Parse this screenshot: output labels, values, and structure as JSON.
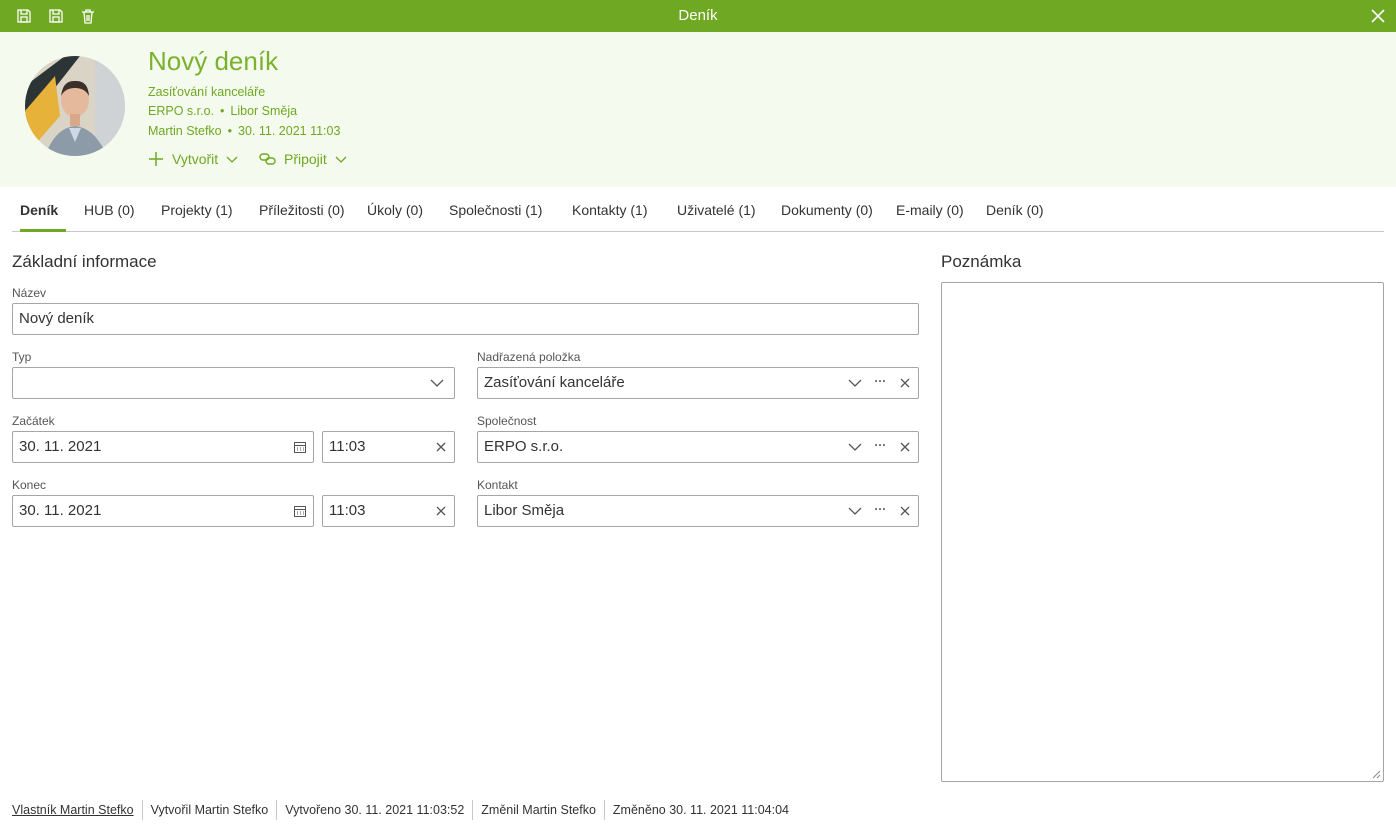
{
  "window": {
    "title": "Deník",
    "accent": "#6fa823"
  },
  "toolbar": {
    "icons": [
      "save-close-icon",
      "save-icon",
      "trash-icon"
    ]
  },
  "header": {
    "title": "Nový deník",
    "parent": "Zasíťování kanceláře",
    "company": "ERPO s.r.o.",
    "contact": "Libor Směja",
    "author": "Martin Stefko",
    "datetime": "30. 11. 2021 11:03",
    "separator": "•",
    "create_label": "Vytvořit",
    "connect_label": "Připojit"
  },
  "tabs": [
    {
      "label": "Deník"
    },
    {
      "label": "HUB (0)"
    },
    {
      "label": "Projekty (1)"
    },
    {
      "label": "Příležitosti (0)"
    },
    {
      "label": "Úkoly (0)"
    },
    {
      "label": "Společnosti (1)"
    },
    {
      "label": "Kontakty (1)"
    },
    {
      "label": "Uživatelé (1)"
    },
    {
      "label": "Dokumenty (0)"
    },
    {
      "label": "E-maily (0)"
    },
    {
      "label": "Deník (0)"
    }
  ],
  "form": {
    "section_title": "Základní informace",
    "name_label": "Název",
    "name_value": "Nový deník",
    "type_label": "Typ",
    "type_value": "",
    "parent_label": "Nadřazená položka",
    "parent_value": "Zasíťování kanceláře",
    "start_label": "Začátek",
    "start_date": "30. 11. 2021",
    "start_time": "11:03",
    "company_label": "Společnost",
    "company_value": "ERPO s.r.o.",
    "end_label": "Konec",
    "end_date": "30. 11. 2021",
    "end_time": "11:03",
    "contact_label": "Kontakt",
    "contact_value": "Libor Směja"
  },
  "note": {
    "title": "Poznámka",
    "value": ""
  },
  "footer": {
    "owner": "Vlastník Martin Stefko",
    "created_by": "Vytvořil Martin Stefko",
    "created_at": "Vytvořeno 30. 11. 2021 11:03:52",
    "modified_by": "Změnil Martin Stefko",
    "modified_at": "Změněno 30. 11. 2021 11:04:04"
  }
}
